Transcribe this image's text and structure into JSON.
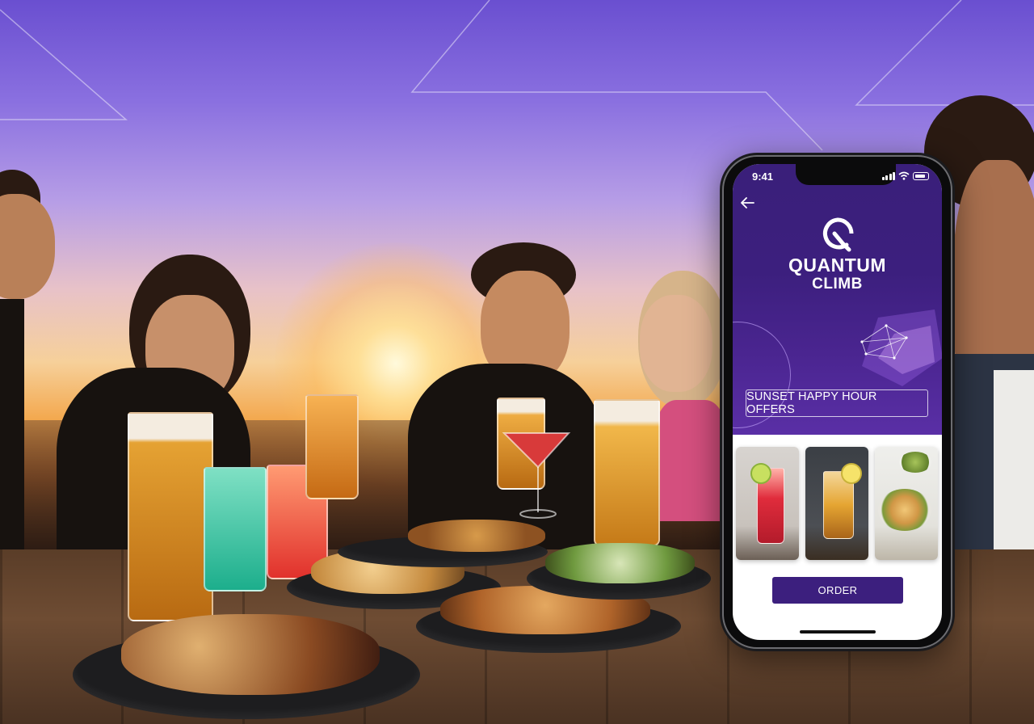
{
  "phone": {
    "status_bar": {
      "time": "9:41",
      "icons": [
        "signal-icon",
        "wifi-icon",
        "battery-icon"
      ]
    },
    "nav": {
      "back_icon": "back-arrow-icon"
    },
    "brand": {
      "logo_icon": "quantum-climb-logo-icon",
      "line1": "QUANTUM",
      "line2": "CLIMB"
    },
    "offer_button_label": "SUNSET HAPPY HOUR OFFERS",
    "cards": [
      {
        "name": "red-cocktail"
      },
      {
        "name": "iced-drink"
      },
      {
        "name": "food-platter"
      }
    ],
    "order_button_label": "ORDER"
  },
  "colors": {
    "brand_purple": "#3c1f7e",
    "sky_top": "#6a4fd0",
    "sunset_orange": "#f3a84e"
  }
}
